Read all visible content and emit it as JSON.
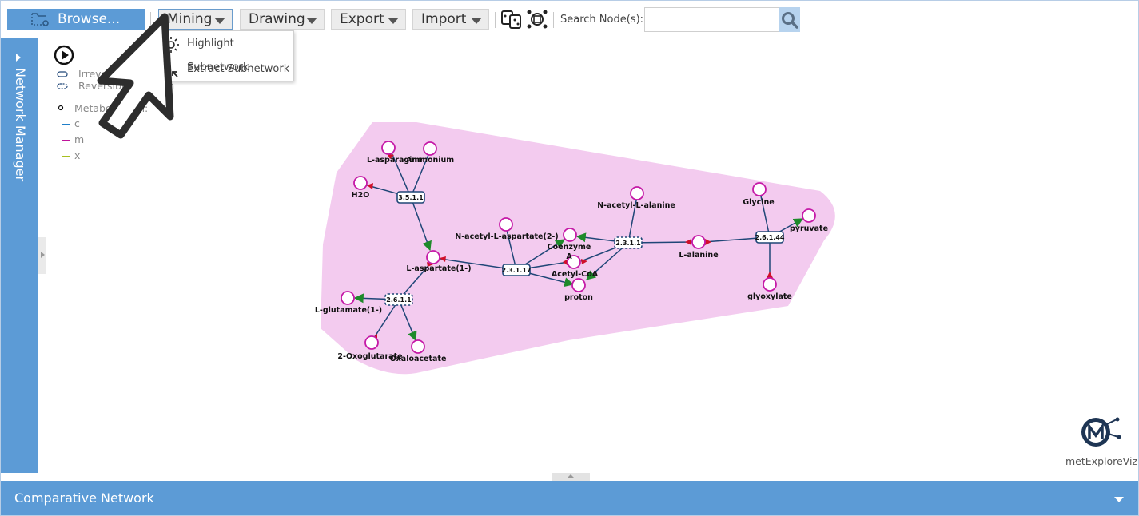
{
  "toolbar": {
    "browse_label": "Browse...",
    "menus": [
      {
        "label": "Mining"
      },
      {
        "label": "Drawing"
      },
      {
        "label": "Export"
      },
      {
        "label": "Import"
      }
    ],
    "search_label": "Search Node(s):",
    "search_value": "",
    "icons": [
      "compare-networks-icon",
      "network-selection-icon",
      "search-icon"
    ]
  },
  "mining_menu": {
    "items": [
      {
        "label": "Highlight Subnetwork",
        "icon": "highlight-icon"
      },
      {
        "label": "Extract Subnetwork",
        "icon": "extract-icon"
      }
    ]
  },
  "side_panel": {
    "label": "Network Manager"
  },
  "legend": {
    "irreversible": "Irreversible reaction",
    "reversible": "Reversible reaction",
    "metabolites": "Metabolites in:",
    "compartments": [
      {
        "label": "c",
        "color": "#1f7fc9"
      },
      {
        "label": "m",
        "color": "#c0149b"
      },
      {
        "label": "x",
        "color": "#a7c020"
      }
    ]
  },
  "network": {
    "hull_color": "#f3cbef",
    "metabolite_color": "#c51aa7",
    "edge_color": "#1f4677",
    "reactions": [
      {
        "id": "r1",
        "label": "3.5.1.1",
        "reversible": false
      },
      {
        "id": "r2",
        "label": "2.3.1.17",
        "reversible": false
      },
      {
        "id": "r3",
        "label": "2.6.1.1",
        "reversible": true
      },
      {
        "id": "r4",
        "label": "2.3.1.1",
        "reversible": true
      },
      {
        "id": "r5",
        "label": "2.6.1.44",
        "reversible": false
      }
    ],
    "metabolites": [
      {
        "id": "m1",
        "label": "L-asparagine"
      },
      {
        "id": "m2",
        "label": "Ammonium"
      },
      {
        "id": "m3",
        "label": "H2O"
      },
      {
        "id": "m4",
        "label": "L-aspartate(1-)"
      },
      {
        "id": "m5",
        "label": "N-acetyl-L-aspartate(2-)"
      },
      {
        "id": "m6",
        "label": "Coenzyme A"
      },
      {
        "id": "m7",
        "label": "Acetyl-CoA"
      },
      {
        "id": "m8",
        "label": "proton"
      },
      {
        "id": "m9",
        "label": "N-acetyl-L-alanine"
      },
      {
        "id": "m10",
        "label": "L-alanine"
      },
      {
        "id": "m11",
        "label": "Glycine"
      },
      {
        "id": "m12",
        "label": "pyruvate"
      },
      {
        "id": "m13",
        "label": "glyoxylate"
      },
      {
        "id": "m14",
        "label": "L-glutamate(1-)"
      },
      {
        "id": "m15",
        "label": "2-Oxoglutarate"
      },
      {
        "id": "m16",
        "label": "Oxaloacetate"
      }
    ]
  },
  "brand": {
    "name": "metExploreViz"
  },
  "bottom_panel": {
    "label": "Comparative Network"
  }
}
